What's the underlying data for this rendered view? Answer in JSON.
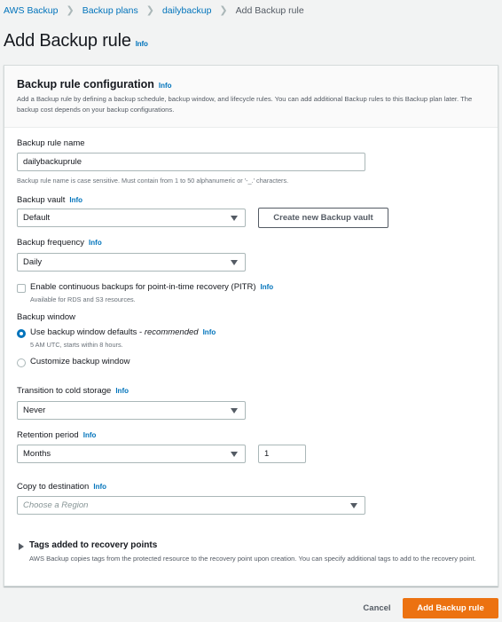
{
  "breadcrumb": {
    "items": [
      {
        "label": "AWS Backup"
      },
      {
        "label": "Backup plans"
      },
      {
        "label": "dailybackup"
      }
    ],
    "current": "Add Backup rule"
  },
  "page": {
    "title": "Add Backup rule",
    "info": "Info"
  },
  "panel": {
    "title": "Backup rule configuration",
    "info": "Info",
    "description": "Add a Backup rule by defining a backup schedule, backup window, and lifecycle rules. You can add additional Backup rules to this Backup plan later. The backup cost depends on your backup configurations."
  },
  "form": {
    "rule_name": {
      "label": "Backup rule name",
      "value": "dailybackuprule",
      "hint": "Backup rule name is case sensitive. Must contain from 1 to 50 alphanumeric or '-_.' characters."
    },
    "vault": {
      "label": "Backup vault",
      "info": "Info",
      "selected": "Default",
      "create_button": "Create new Backup vault"
    },
    "frequency": {
      "label": "Backup frequency",
      "info": "Info",
      "selected": "Daily"
    },
    "pitr": {
      "label": "Enable continuous backups for point-in-time recovery (PITR)",
      "info": "Info",
      "hint": "Available for RDS and S3 resources.",
      "checked": false
    },
    "window": {
      "label": "Backup window",
      "options": [
        {
          "label": "Use backup window defaults - ",
          "emphasis": "recommended",
          "info": "Info",
          "hint": "5 AM UTC, starts within 8 hours.",
          "checked": true
        },
        {
          "label": "Customize backup window",
          "checked": false
        }
      ]
    },
    "cold_storage": {
      "label": "Transition to cold storage",
      "info": "Info",
      "selected": "Never"
    },
    "retention": {
      "label": "Retention period",
      "info": "Info",
      "unit": "Months",
      "value": "1"
    },
    "copy": {
      "label": "Copy to destination",
      "info": "Info",
      "placeholder": "Choose a Region"
    },
    "tags": {
      "title": "Tags added to recovery points",
      "description": "AWS Backup copies tags from the protected resource to the recovery point upon creation. You can specify additional tags to add to the recovery point."
    }
  },
  "footer": {
    "cancel": "Cancel",
    "submit": "Add Backup rule"
  },
  "colors": {
    "primary": "#ec7211",
    "link": "#0073bb",
    "background": "#f2f3f3"
  }
}
